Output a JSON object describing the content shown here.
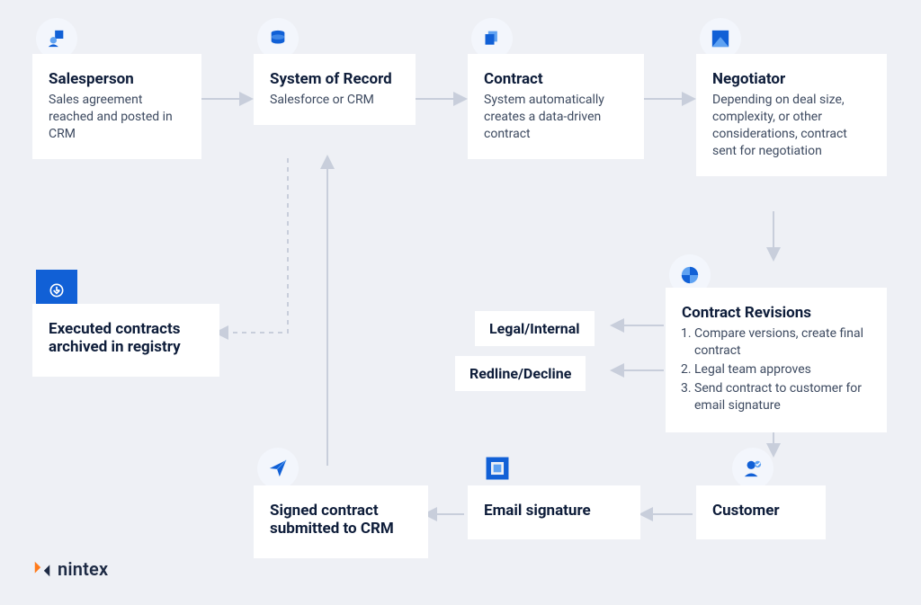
{
  "nodes": {
    "salesperson": {
      "title": "Salesperson",
      "desc": "Sales agreement reached and posted in CRM"
    },
    "system_of_record": {
      "title": "System of Record",
      "desc": "Salesforce or CRM"
    },
    "contract": {
      "title": "Contract",
      "desc": "System automatically creates a data-driven contract"
    },
    "negotiator": {
      "title": "Negotiator",
      "desc": "Depending on deal size, complexity, or other considerations, contract sent for negotiation"
    },
    "revisions": {
      "title": "Contract Revisions",
      "items": [
        "Compare versions, create final contract",
        "Legal team approves",
        "Send contract to customer for email signature"
      ]
    },
    "customer": {
      "title": "Customer"
    },
    "email_signature": {
      "title": "Email signature"
    },
    "signed": {
      "title": "Signed contract submitted to CRM"
    },
    "archived": {
      "title": "Executed contracts archived in registry"
    }
  },
  "labels": {
    "legal_internal": "Legal/Internal",
    "redline_decline": "Redline/Decline"
  },
  "brand": "nintex",
  "colors": {
    "accent": "#1160d6",
    "accent_light": "#5fa2f2",
    "line": "#d0d6e2",
    "line_dashed": "#c8cedb",
    "text": "#1d2a44"
  }
}
